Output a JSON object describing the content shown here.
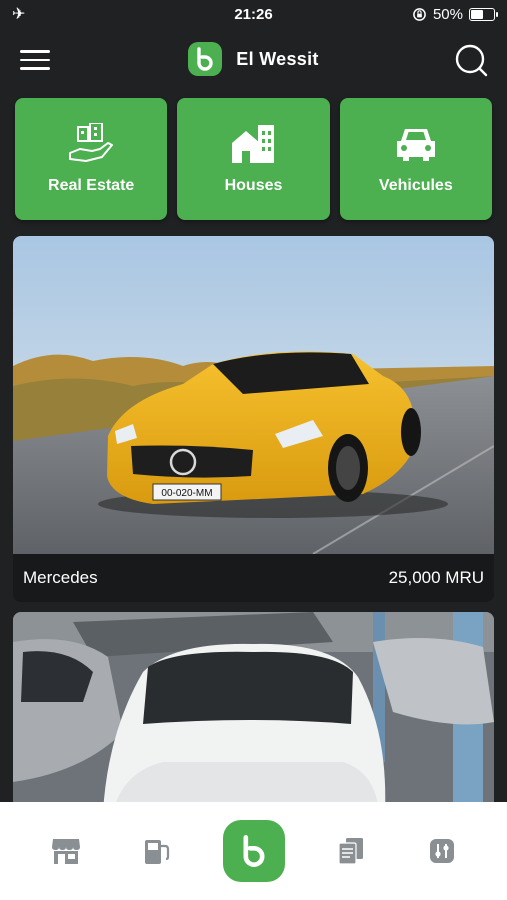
{
  "status_bar": {
    "time": "21:26",
    "battery": "50%",
    "battery_level": 0.5,
    "icons": [
      "airplane-icon",
      "orientation-lock-icon",
      "battery-icon"
    ]
  },
  "header": {
    "title": "El Wessit",
    "logo_letter": "b",
    "icons": [
      "menu-icon",
      "search-icon"
    ]
  },
  "categories": [
    {
      "label": "Real Estate",
      "icon": "real-estate-icon"
    },
    {
      "label": "Houses",
      "icon": "house-icon"
    },
    {
      "label": "Vehicules",
      "icon": "car-icon"
    }
  ],
  "listings": [
    {
      "title": "Mercedes",
      "price": "25,000 MRU",
      "plate": "00-020-MM"
    },
    {
      "title": "",
      "price": ""
    }
  ],
  "bottom_nav": [
    "store-icon",
    "gas-station-icon",
    "home-logo-icon",
    "documents-icon",
    "settings-icon"
  ],
  "colors": {
    "accent": "#4caf50",
    "background": "#1f2123",
    "card": "#17191a",
    "nav_bg": "#ffffff",
    "nav_icon": "#8a8f94"
  }
}
